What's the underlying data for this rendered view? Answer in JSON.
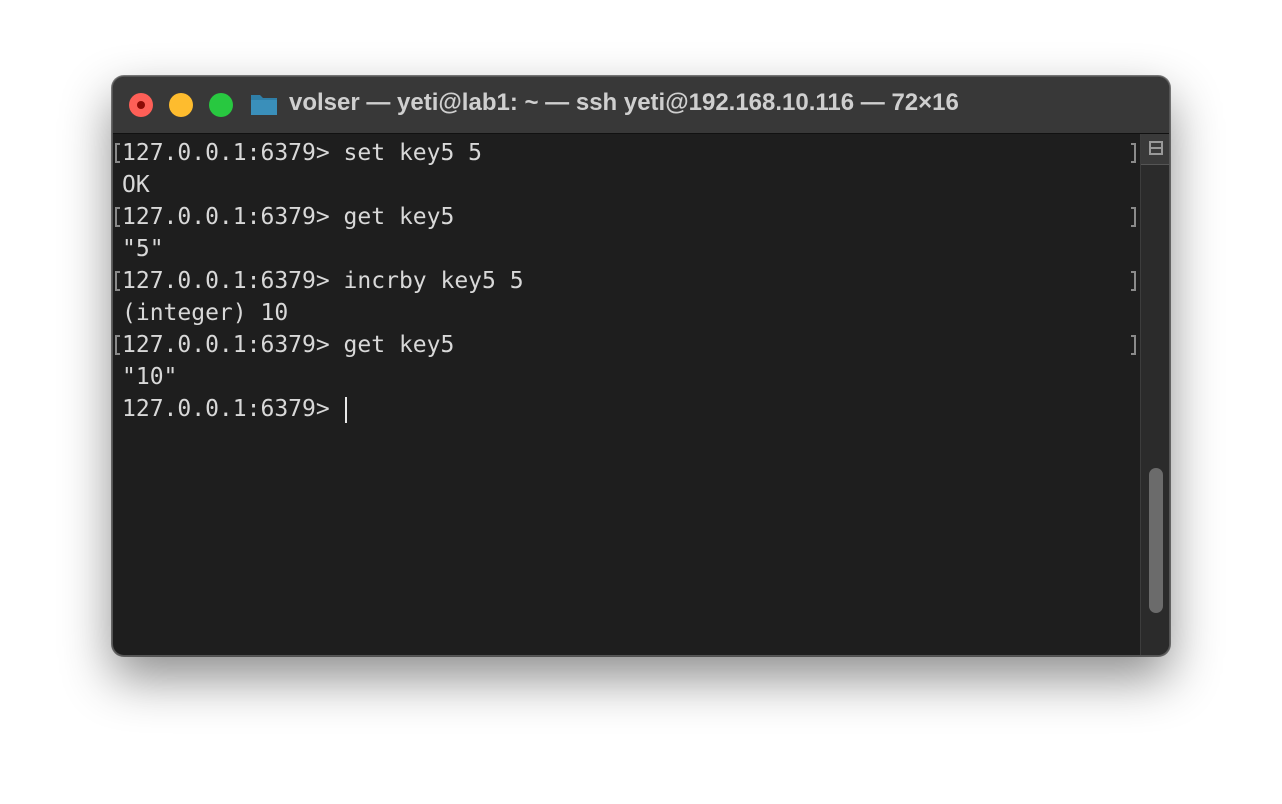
{
  "window": {
    "title": "volser — yeti@lab1: ~ — ssh yeti@192.168.10.116 — 72×16"
  },
  "terminal": {
    "lines": [
      {
        "text": "127.0.0.1:6379> set key5 5",
        "marked": true
      },
      {
        "text": "OK",
        "marked": false
      },
      {
        "text": "127.0.0.1:6379> get key5",
        "marked": true
      },
      {
        "text": "\"5\"",
        "marked": false
      },
      {
        "text": "127.0.0.1:6379> incrby key5 5",
        "marked": true
      },
      {
        "text": "(integer) 10",
        "marked": false
      },
      {
        "text": "127.0.0.1:6379> get key5",
        "marked": true
      },
      {
        "text": "\"10\"",
        "marked": false
      },
      {
        "text": "127.0.0.1:6379> ",
        "marked": false
      }
    ]
  },
  "scrollbar": {
    "position": 0.85
  }
}
